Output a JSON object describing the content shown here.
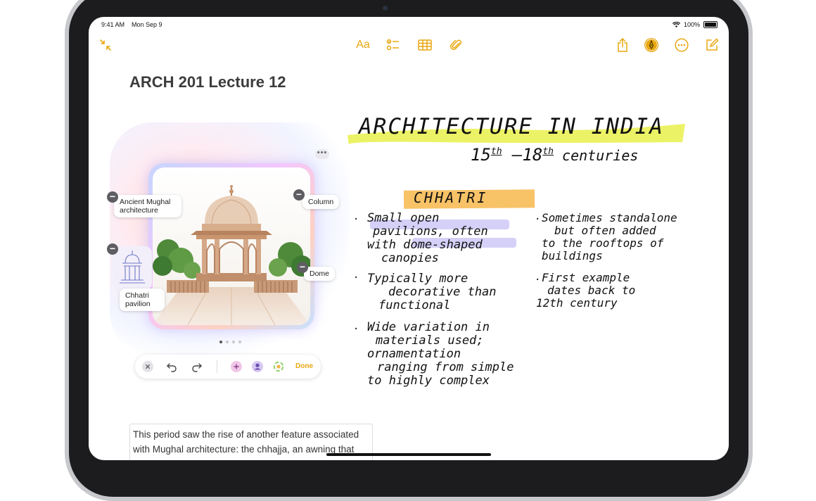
{
  "status": {
    "time": "9:41 AM",
    "date": "Mon Sep 9",
    "battery": "100%"
  },
  "toolbar": {
    "collapse_icon": "arrows-in-icon",
    "format_label": "Aa",
    "icons": [
      "checklist-icon",
      "table-icon",
      "paperclip-icon",
      "share-icon",
      "markup-pen-icon",
      "more-icon",
      "compose-icon"
    ]
  },
  "note": {
    "title": "ARCH 201 Lecture 12"
  },
  "image_panel": {
    "chips": {
      "ancient": "Ancient Mughal architecture",
      "column": "Column",
      "dome": "Dome",
      "chhatri": "Chhatri pavilion"
    },
    "page_count": 4,
    "current_page": 1,
    "toolbar": {
      "done_label": "Done"
    }
  },
  "handwriting": {
    "heading": "ARCHITECTURE IN INDIA",
    "subheading_start": "15",
    "subheading_start_sup": "th",
    "subheading_mid": " –18",
    "subheading_end_sup": "th",
    "subheading_tail": " centuries",
    "section": "CHHATRI",
    "bullets_left": [
      [
        "Small open",
        "pavilions, often",
        "with dome-shaped",
        "canopies"
      ],
      [
        "Typically more",
        "decorative than",
        "functional"
      ],
      [
        "Wide variation in",
        "materials used;",
        "ornamentation",
        "ranging from simple",
        "to highly complex"
      ]
    ],
    "bullets_right": [
      [
        "Sometimes standalone",
        "but often added",
        "to the rooftops of",
        "buildings"
      ],
      [
        "First example",
        "dates back to",
        "12th century"
      ]
    ]
  },
  "body_text": "This period saw the rise of another feature associated with Mughal architecture: the chhajja, an awning that extends away from buildings and is",
  "colors": {
    "accent": "#e8a710",
    "highlight_yellow": "#e9f04a",
    "highlight_orange": "#f7b74c",
    "highlight_purple": "#c9c4f5"
  }
}
